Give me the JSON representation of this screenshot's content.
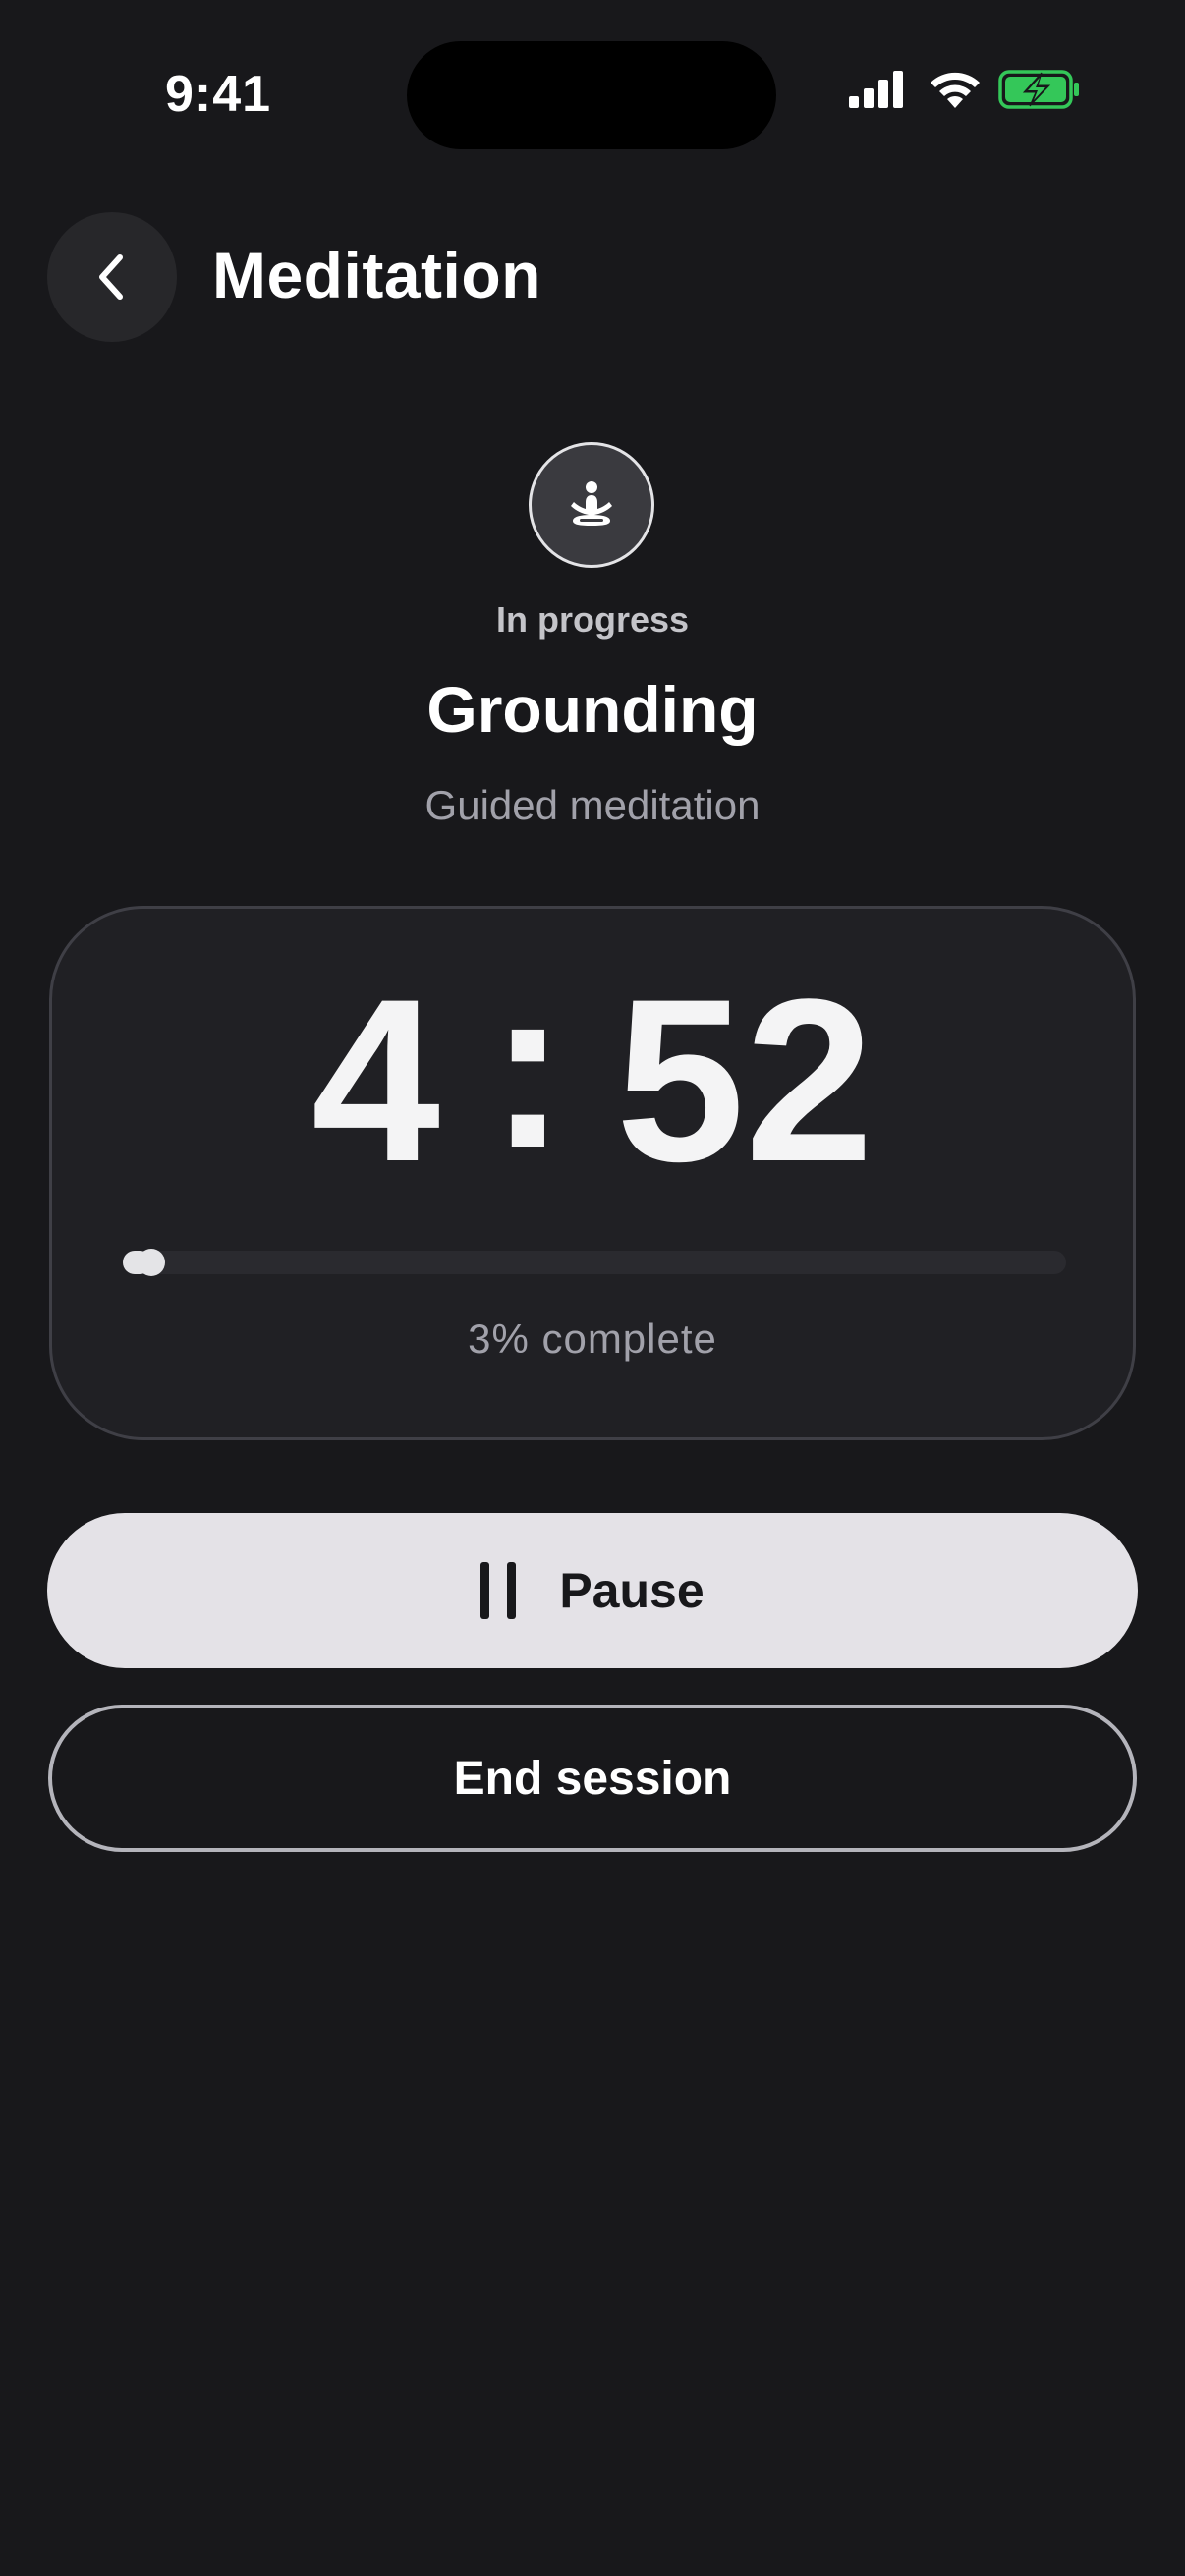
{
  "status_bar": {
    "time": "9:41",
    "icons": [
      "cellular-signal-icon",
      "wifi-icon",
      "battery-charging-icon"
    ],
    "battery_color": "#34c759"
  },
  "header": {
    "back_icon": "chevron-left-icon",
    "title": "Meditation"
  },
  "session": {
    "icon": "meditation-pose-icon",
    "status": "In progress",
    "name": "Grounding",
    "type": "Guided meditation"
  },
  "timer": {
    "minutes": "4",
    "separator": ":",
    "seconds": "52",
    "progress_percent": 3,
    "progress_text": "3% complete"
  },
  "actions": {
    "pause_icon": "pause-icon",
    "pause_label": "Pause",
    "end_label": "End session"
  },
  "colors": {
    "background": "#18181b",
    "card": "#202024",
    "primary_button": "#e4e2e7",
    "text_primary": "#ffffff",
    "text_secondary": "#a1a1aa"
  }
}
